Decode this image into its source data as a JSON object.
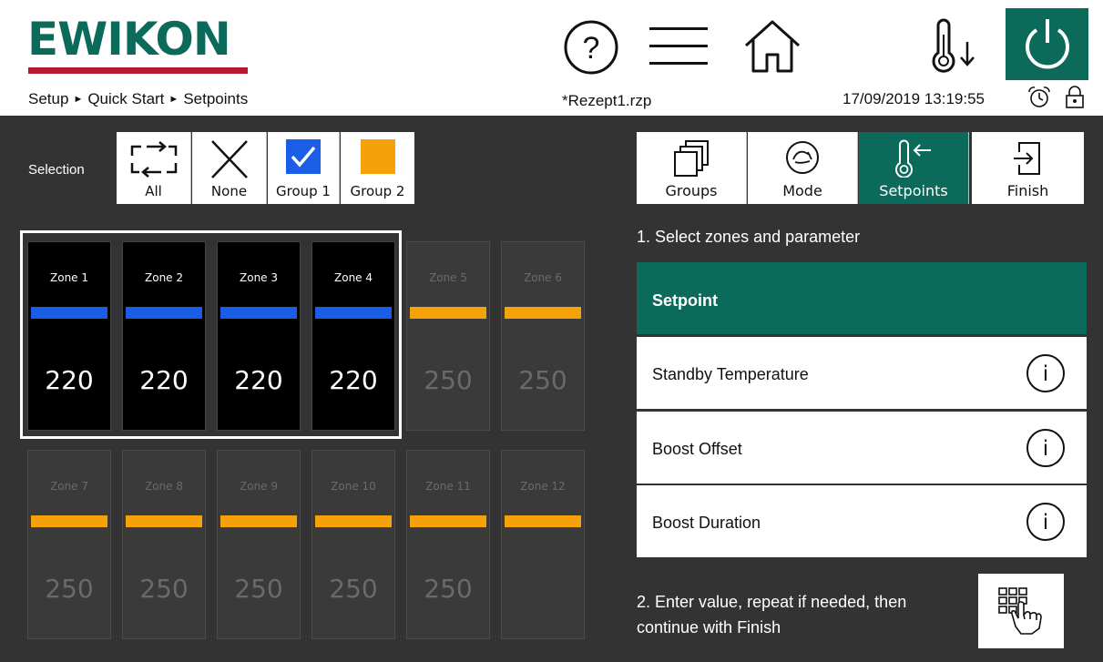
{
  "header": {
    "logo_text": "EWIKON",
    "breadcrumb": [
      "Setup",
      "Quick Start",
      "Setpoints"
    ],
    "breadcrumb_sep": "►",
    "recipe_file": "*Rezept1.rzp",
    "datetime": "17/09/2019 13:19:55",
    "icons": [
      "help-icon",
      "menu-icon",
      "home-icon",
      "temperature-down-icon",
      "power-icon",
      "alarm-clock-icon",
      "lock-icon"
    ],
    "colors": {
      "brand_green": "#0c6a5a",
      "brand_red": "#b3182d"
    }
  },
  "selection": {
    "label": "Selection",
    "buttons": [
      {
        "label": "All",
        "icon": "select-all-icon"
      },
      {
        "label": "None",
        "icon": "cross-icon"
      },
      {
        "label": "Group 1",
        "icon": "checkbox-checked-icon",
        "color": "#1a5ee6"
      },
      {
        "label": "Group 2",
        "icon": "square-icon",
        "color": "#f5a10a"
      }
    ]
  },
  "zones": [
    {
      "name": "Zone 1",
      "value": "220",
      "selected": true,
      "bar": "#1a5ee6"
    },
    {
      "name": "Zone 2",
      "value": "220",
      "selected": true,
      "bar": "#1a5ee6"
    },
    {
      "name": "Zone 3",
      "value": "220",
      "selected": true,
      "bar": "#1a5ee6"
    },
    {
      "name": "Zone 4",
      "value": "220",
      "selected": true,
      "bar": "#1a5ee6"
    },
    {
      "name": "Zone 5",
      "value": "250",
      "selected": false,
      "bar": "#f5a10a"
    },
    {
      "name": "Zone 6",
      "value": "250",
      "selected": false,
      "bar": "#f5a10a"
    },
    {
      "name": "Zone 7",
      "value": "250",
      "selected": false,
      "bar": "#f5a10a"
    },
    {
      "name": "Zone 8",
      "value": "250",
      "selected": false,
      "bar": "#f5a10a"
    },
    {
      "name": "Zone 9",
      "value": "250",
      "selected": false,
      "bar": "#f5a10a"
    },
    {
      "name": "Zone 10",
      "value": "250",
      "selected": false,
      "bar": "#f5a10a"
    },
    {
      "name": "Zone 11",
      "value": "250",
      "selected": false,
      "bar": "#f5a10a"
    },
    {
      "name": "Zone 12",
      "value": "",
      "selected": false,
      "bar": "#f5a10a"
    }
  ],
  "tabs": [
    {
      "label": "Groups",
      "icon": "groups-icon",
      "active": false
    },
    {
      "label": "Mode",
      "icon": "mode-icon",
      "active": false
    },
    {
      "label": "Setpoints",
      "icon": "thermometer-arrow-icon",
      "active": true
    },
    {
      "label": "Finish",
      "icon": "exit-icon",
      "active": false
    }
  ],
  "instructions": {
    "step1": "1. Select zones and parameter",
    "step2": "2. Enter value, repeat if needed, then continue with Finish"
  },
  "parameters": [
    {
      "label": "Setpoint",
      "active": true,
      "info": false
    },
    {
      "label": "Standby Temperature",
      "active": false,
      "info": true
    },
    {
      "label": "Boost Offset",
      "active": false,
      "info": true
    },
    {
      "label": "Boost Duration",
      "active": false,
      "info": true
    }
  ],
  "info_glyph": "i"
}
